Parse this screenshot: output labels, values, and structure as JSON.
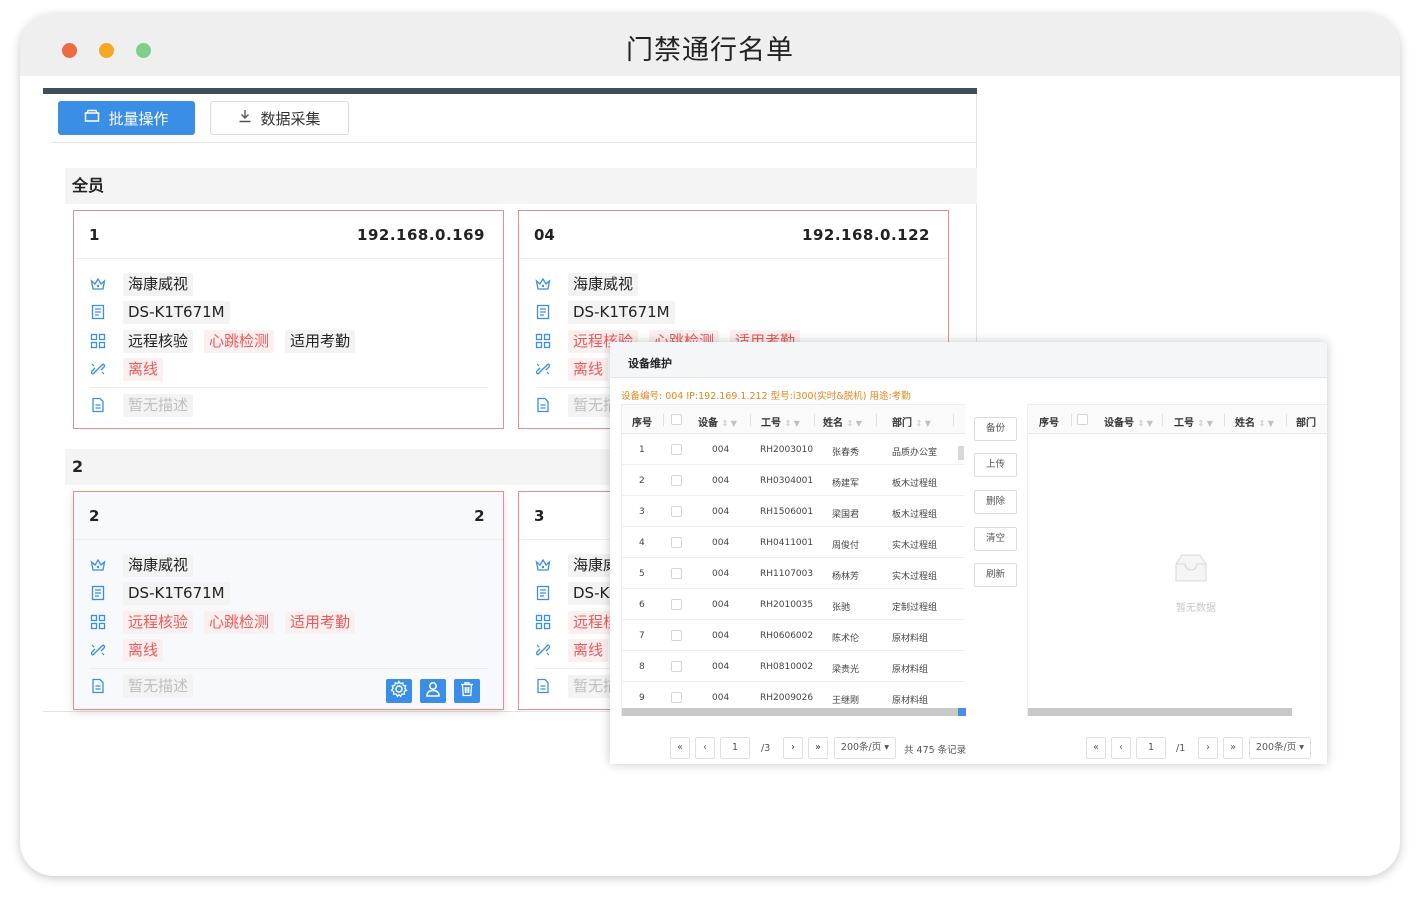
{
  "window": {
    "title": "门禁通行名单"
  },
  "toolbar": {
    "batch_label": "批量操作",
    "collect_label": "数据采集"
  },
  "groups": [
    {
      "name": "全员",
      "cards": [
        {
          "id": "1",
          "right": "192.168.0.169",
          "brand": "海康威视",
          "model": "DS-K1T671M",
          "features": [
            {
              "text": "远程核验",
              "red": false
            },
            {
              "text": "心跳检测",
              "red": true
            },
            {
              "text": "适用考勤",
              "red": false
            }
          ],
          "status": "离线",
          "desc": "暂无描述"
        },
        {
          "id": "04",
          "right": "192.168.0.122",
          "brand": "海康威视",
          "model": "DS-K1T671M",
          "features": [
            {
              "text": "远程核验",
              "red": true
            },
            {
              "text": "心跳检测",
              "red": true
            },
            {
              "text": "适用考勤",
              "red": true
            }
          ],
          "status": "离线",
          "desc": "暂无描述"
        }
      ]
    },
    {
      "name": "2",
      "cards": [
        {
          "id": "2",
          "right": "2",
          "brand": "海康威视",
          "model": "DS-K1T671M",
          "features": [
            {
              "text": "远程核验",
              "red": true
            },
            {
              "text": "心跳检测",
              "red": true
            },
            {
              "text": "适用考勤",
              "red": true
            }
          ],
          "status": "离线",
          "desc": "暂无描述"
        },
        {
          "id": "3",
          "right": "",
          "brand": "海康威视",
          "model": "DS-K1T671M",
          "features": [
            {
              "text": "远程核验",
              "red": true
            }
          ],
          "status": "离线",
          "desc": "暂无描述"
        }
      ]
    }
  ],
  "dialog": {
    "title": "设备维护",
    "info": "设备编号: 004   IP:192.169.1.212   型号:i300(实时&脱机)   用途:考勤",
    "left_table": {
      "headers": [
        "序号",
        "设备",
        "工号",
        "姓名",
        "部门"
      ],
      "rows": [
        [
          "1",
          "004",
          "RH2003010",
          "张春秀",
          "品质办公室"
        ],
        [
          "2",
          "004",
          "RH0304001",
          "杨建军",
          "板木过程组"
        ],
        [
          "3",
          "004",
          "RH1506001",
          "梁国君",
          "板木过程组"
        ],
        [
          "4",
          "004",
          "RH0411001",
          "周俊付",
          "实木过程组"
        ],
        [
          "5",
          "004",
          "RH1107003",
          "杨林芳",
          "实木过程组"
        ],
        [
          "6",
          "004",
          "RH2010035",
          "张驰",
          "定制过程组"
        ],
        [
          "7",
          "004",
          "RH0606002",
          "陈术伦",
          "原材料组"
        ],
        [
          "8",
          "004",
          "RH0810002",
          "梁贵光",
          "原材料组"
        ],
        [
          "9",
          "004",
          "RH2009026",
          "王继刚",
          "原材料组"
        ]
      ]
    },
    "middle_buttons": [
      "备份",
      "上传",
      "删除",
      "清空",
      "刷新"
    ],
    "right_table": {
      "headers": [
        "序号",
        "设备号",
        "工号",
        "姓名",
        "部门"
      ],
      "empty_text": "暂无数据"
    },
    "left_pager": {
      "page": "1",
      "total_pages": "/3",
      "page_size": "200条/页",
      "total": "共 475 条记录"
    },
    "right_pager": {
      "page": "1",
      "total_pages": "/1",
      "page_size": "200条/页"
    }
  }
}
